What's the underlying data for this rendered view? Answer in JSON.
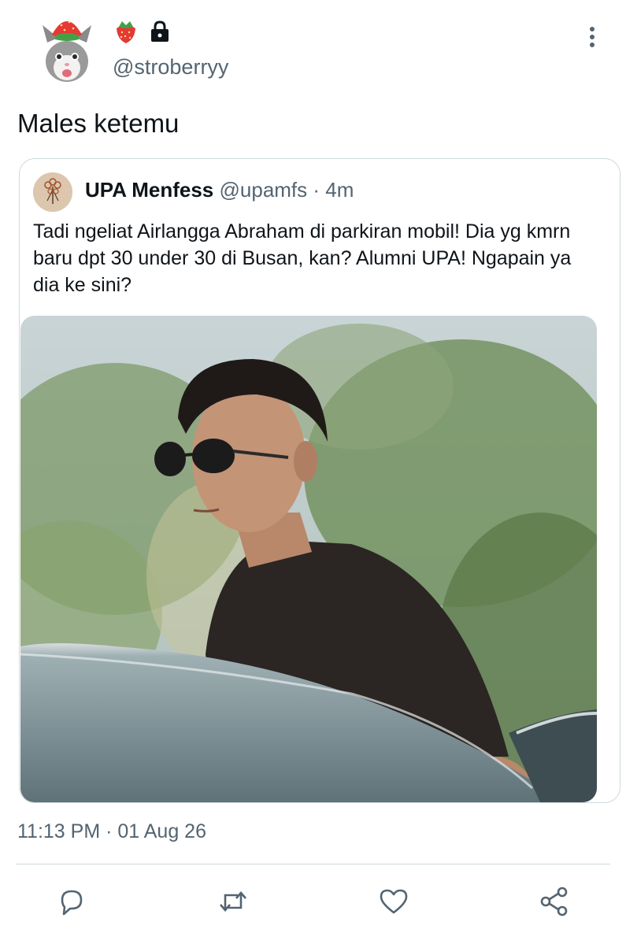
{
  "header": {
    "handle": "@stroberryy",
    "badges": [
      "strawberry-emoji",
      "lock-icon"
    ],
    "more_icon": "vertical-dots-icon"
  },
  "tweet": {
    "text": "Males ketemu",
    "timestamp": "11:13 PM · 01 Aug 26"
  },
  "quoted": {
    "name": "UPA Menfess",
    "username": "@upamfs",
    "separator": " · ",
    "time": "4m",
    "text": "Tadi ngeliat Airlangga Abraham di parkiran mobil! Dia yg kmrn baru dpt 30 under 30 di Busan, kan? Alumni UPA! Ngapain ya dia ke sini?",
    "image_alt": "man-in-sunglasses-by-car-photo"
  },
  "actions": [
    "reply-icon",
    "retweet-icon",
    "like-icon",
    "share-icon"
  ],
  "colors": {
    "text": "#0f1419",
    "secondary": "#536471",
    "border": "#cfd9de",
    "icon": "#536471"
  }
}
